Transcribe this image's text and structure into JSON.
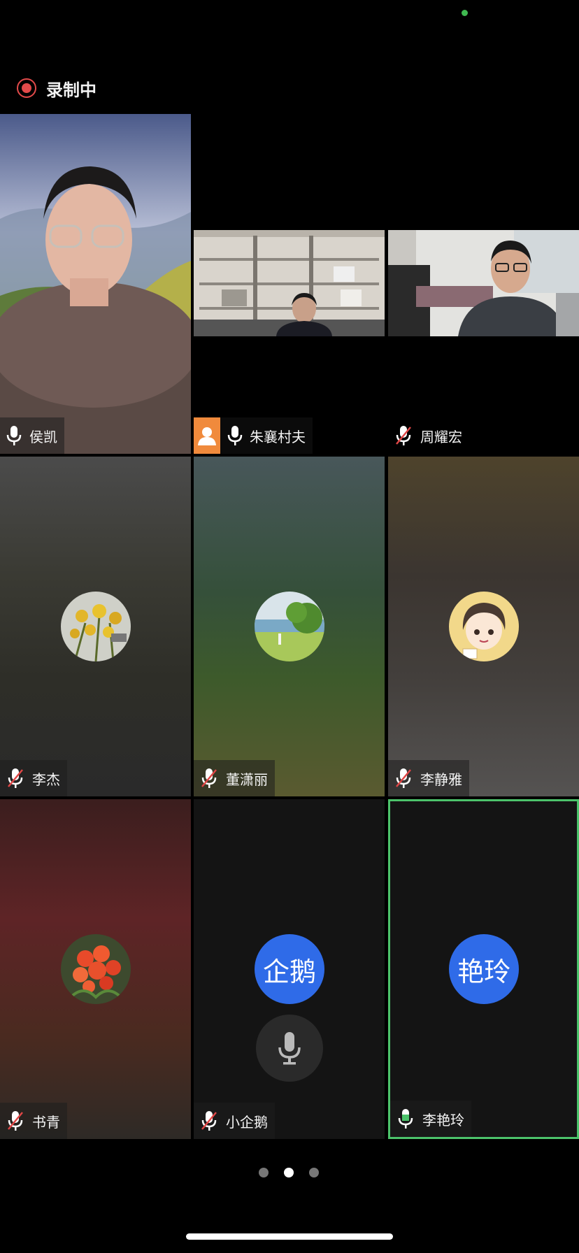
{
  "status": {
    "indicator_color": "#3fb950"
  },
  "recording": {
    "label": "录制中",
    "color": "#e24a4a"
  },
  "participants": [
    {
      "name": "侯凯",
      "mic": "on"
    },
    {
      "name": "朱襄村夫",
      "mic": "on"
    },
    {
      "name": "周耀宏",
      "mic": "muted"
    },
    {
      "name": "李杰",
      "mic": "muted"
    },
    {
      "name": "董潇丽",
      "mic": "muted"
    },
    {
      "name": "李静雅",
      "mic": "muted"
    },
    {
      "name": "书青",
      "mic": "muted"
    },
    {
      "name": "小企鹅",
      "mic": "muted",
      "avatar_text": "企鹅"
    },
    {
      "name": "李艳玲",
      "mic": "speaking",
      "avatar_text": "艳玲",
      "active_speaker": true
    }
  ],
  "pager": {
    "pages": 3,
    "current": 2
  },
  "colors": {
    "avatar_blue": "#2f6be8",
    "speaking_green": "#4cc36b",
    "host_badge": "#f08a3c"
  }
}
